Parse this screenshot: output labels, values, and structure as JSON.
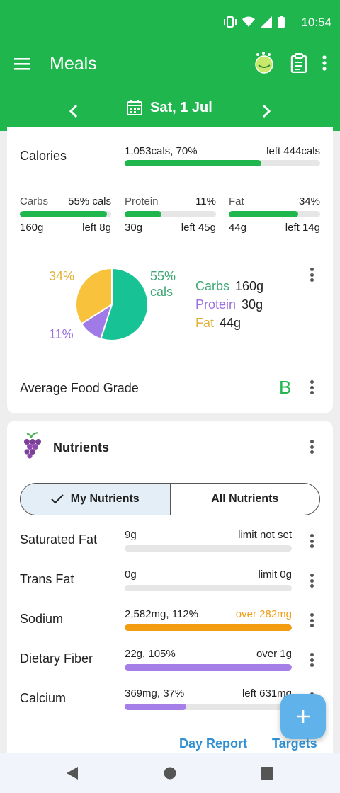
{
  "status_bar": {
    "time": "10:54"
  },
  "app_bar": {
    "title": "Meals",
    "menu_icon": "hamburger-menu-icon",
    "icons": [
      "tape-measure-icon",
      "clipboard-icon",
      "more-vert-icon"
    ]
  },
  "date_bar": {
    "date_label": "Sat, 1 Jul"
  },
  "calories": {
    "label": "Calories",
    "value_text": "1,053cals, 70%",
    "left_text": "left 444cals",
    "progress": 0.7,
    "color": "#20b64e"
  },
  "macros": [
    {
      "name": "Carbs",
      "pct": "55% cals",
      "amount": "160g",
      "left": "left 8g",
      "progress": 0.95
    },
    {
      "name": "Protein",
      "pct": "11%",
      "amount": "30g",
      "left": "left 45g",
      "progress": 0.4
    },
    {
      "name": "Fat",
      "pct": "34%",
      "amount": "44g",
      "left": "left 14g",
      "progress": 0.76
    }
  ],
  "pie": {
    "label_fat": "34%",
    "label_carbs_pct": "55%",
    "label_carbs_unit": "cals",
    "label_protein": "11%",
    "colors": {
      "carbs": "#17c395",
      "protein": "#a07ae6",
      "fat": "#f9c23c"
    },
    "legend": [
      {
        "name": "Carbs",
        "value": "160g",
        "color": "#3fa675"
      },
      {
        "name": "Protein",
        "value": "30g",
        "color": "#9b6fe0"
      },
      {
        "name": "Fat",
        "value": "44g",
        "color": "#e0b23a"
      }
    ]
  },
  "chart_data": {
    "type": "pie",
    "categories": [
      "Carbs",
      "Protein",
      "Fat"
    ],
    "values": [
      55,
      11,
      34
    ]
  },
  "food_grade": {
    "label": "Average Food Grade",
    "grade": "B"
  },
  "nutrients": {
    "title": "Nutrients",
    "tabs": [
      "My Nutrients",
      "All Nutrients"
    ],
    "rows": [
      {
        "name": "Saturated Fat",
        "value": "9g",
        "right": "limit not set",
        "right_color": "#212121",
        "progress": 0,
        "color": "#bdbdbd"
      },
      {
        "name": "Trans Fat",
        "value": "0g",
        "right": "limit 0g",
        "right_color": "#212121",
        "progress": 0,
        "color": "#bdbdbd"
      },
      {
        "name": "Sodium",
        "value": "2,582mg, 112%",
        "right": "over 282mg",
        "right_color": "#f39c12",
        "progress": 1.0,
        "color": "#f39c12"
      },
      {
        "name": "Dietary Fiber",
        "value": "22g, 105%",
        "right": "over 1g",
        "right_color": "#212121",
        "progress": 1.0,
        "color": "#a67ee8"
      },
      {
        "name": "Calcium",
        "value": "369mg, 37%",
        "right": "left 631mg",
        "right_color": "#212121",
        "progress": 0.37,
        "color": "#a67ee8"
      }
    ]
  },
  "footer": {
    "day_report": "Day Report",
    "targets": "Targets"
  }
}
